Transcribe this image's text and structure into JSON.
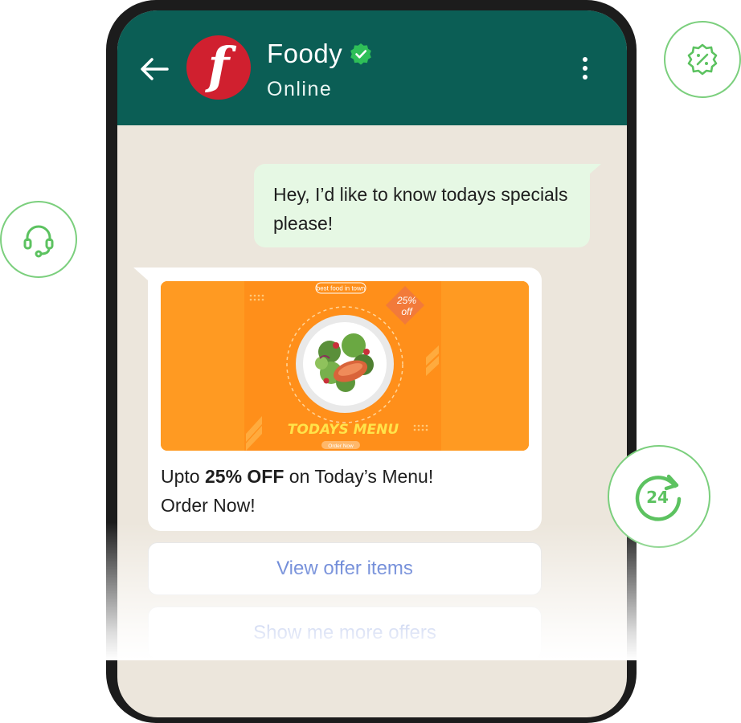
{
  "chat": {
    "contact_name": "Foody",
    "status": "Online",
    "avatar_letter": "f"
  },
  "messages": {
    "outgoing": "Hey, I’d like to know todays specials please!",
    "incoming": {
      "line1_pre": "Upto ",
      "line1_bold": "25% OFF",
      "line1_post": " on Today’s Menu!",
      "line2": "Order Now!"
    }
  },
  "promo": {
    "tagline": "best food in town",
    "discount_top": "25%",
    "discount_bottom": "off",
    "headline": "TODAYS MENU",
    "cta": "Order Now"
  },
  "replies": [
    {
      "label": "View offer items"
    },
    {
      "label": "Show me more offers"
    }
  ],
  "floating_icons": {
    "discount_badge": "discount-badge-icon",
    "headset": "headset-icon",
    "support_24": "24"
  },
  "colors": {
    "header": "#0b5e55",
    "accent_green": "#7bcf7d",
    "link_blue": "#2e56c7",
    "avatar_red": "#d0202f",
    "promo_orange": "#ff9a22"
  }
}
